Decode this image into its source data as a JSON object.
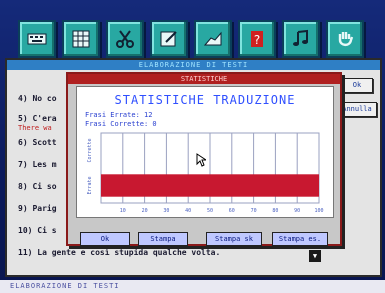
{
  "main_window": {
    "title": "ELABORAZIONE DI TESTI",
    "lines": [
      "4) No co",
      "5) C'era",
      "There wa",
      "6) Scott",
      "7) Les m",
      "8) Ci so",
      "9) Parig",
      "10) Ci s",
      "11) La gente e così stupida qualche volta."
    ],
    "right_buttons": [
      "Ok",
      "Annulla"
    ]
  },
  "dialog": {
    "title": "STATISTICHE",
    "heading": "STATISTICHE TRADUZIONE",
    "stats": {
      "errors_label": "Frasi Errate: 12",
      "correct_label": "Frasi Corrette: 0"
    },
    "buttons": [
      "Ok",
      "Stampa",
      "Stampa sk",
      "Stampa es."
    ]
  },
  "chart_data": {
    "type": "bar",
    "orientation": "horizontal",
    "categories": [
      "Corrette",
      "Errate"
    ],
    "values": [
      0,
      100
    ],
    "xlim": [
      0,
      100
    ],
    "xticks": [
      "10",
      "20",
      "30",
      "40",
      "50",
      "60",
      "70",
      "80",
      "90",
      "100"
    ],
    "grid": true,
    "bar_color": "#c81830"
  },
  "status": {
    "text": "ELABORAZIONE DI TESTI"
  },
  "colors": {
    "desktop": "#0b1a5c",
    "tool": "#28a8a2",
    "dialog_border": "#8a1a1a",
    "heading": "#3050ff"
  },
  "toolbar_icons": [
    "keyboard-icon",
    "grid-icon",
    "scissors-icon",
    "edit-icon",
    "hand-write-icon",
    "question-icon",
    "music-icon",
    "hand-stop-icon"
  ]
}
